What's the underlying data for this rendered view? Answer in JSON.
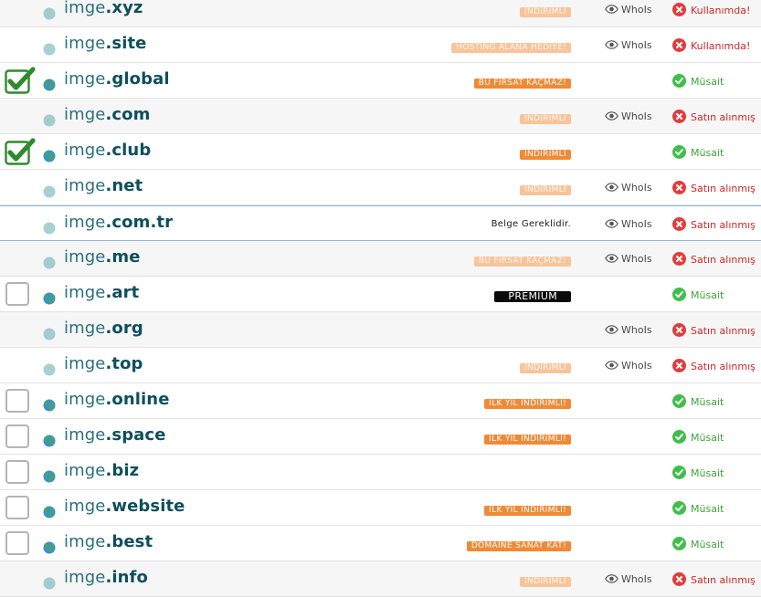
{
  "colors": {
    "accent": "#f08a35",
    "available": "#3fbf4a",
    "taken": "#e23c3c",
    "domain": "#1a5a66"
  },
  "rows": [
    {
      "name": "imge",
      "tld": ".xyz",
      "checkbox": "none",
      "globe_dim": true,
      "badge": "İNDİRİMLİ",
      "badge_style": "dim",
      "whois": "WhoIs",
      "status": "Kullanımda!",
      "status_type": "bad",
      "alt": true
    },
    {
      "name": "imge",
      "tld": ".site",
      "checkbox": "none",
      "globe_dim": true,
      "badge": "HOSTİNG ALANA HEDİYE!",
      "badge_style": "dim",
      "whois": "WhoIs",
      "status": "Kullanımda!",
      "status_type": "bad",
      "alt": false
    },
    {
      "name": "imge",
      "tld": ".global",
      "checkbox": "checked",
      "globe_dim": false,
      "badge": "BU FIRSAT KAÇMAZ!",
      "badge_style": "normal",
      "whois": "",
      "status": "Müsait",
      "status_type": "ok",
      "alt": false
    },
    {
      "name": "imge",
      "tld": ".com",
      "checkbox": "none",
      "globe_dim": true,
      "badge": "İNDİRİMLİ",
      "badge_style": "dim",
      "whois": "WhoIs",
      "status": "Satın alınmış",
      "status_type": "bad",
      "alt": true
    },
    {
      "name": "imge",
      "tld": ".club",
      "checkbox": "checked",
      "globe_dim": false,
      "badge": "İNDİRİMLİ",
      "badge_style": "normal",
      "whois": "",
      "status": "Müsait",
      "status_type": "ok",
      "alt": false
    },
    {
      "name": "imge",
      "tld": ".net",
      "checkbox": "none",
      "globe_dim": true,
      "badge": "İNDİRİMLİ",
      "badge_style": "dim",
      "whois": "WhoIs",
      "status": "Satın alınmış",
      "status_type": "bad",
      "alt": false
    },
    {
      "name": "imge",
      "tld": ".com.tr",
      "checkbox": "none",
      "globe_dim": true,
      "badge": "Belge Gereklidir.",
      "badge_style": "note",
      "whois": "WhoIs",
      "status": "Satın alınmış",
      "status_type": "bad",
      "alt": false,
      "selected": true
    },
    {
      "name": "imge",
      "tld": ".me",
      "checkbox": "none",
      "globe_dim": true,
      "badge": "BU FIRSAT KAÇMAZ!",
      "badge_style": "dim",
      "whois": "WhoIs",
      "status": "Satın alınmış",
      "status_type": "bad",
      "alt": true
    },
    {
      "name": "imge",
      "tld": ".art",
      "checkbox": "empty",
      "globe_dim": false,
      "badge": "PREMIUM",
      "badge_style": "premium",
      "whois": "",
      "status": "Müsait",
      "status_type": "ok",
      "alt": false
    },
    {
      "name": "imge",
      "tld": ".org",
      "checkbox": "none",
      "globe_dim": true,
      "badge": "",
      "badge_style": "",
      "whois": "WhoIs",
      "status": "Satın alınmış",
      "status_type": "bad",
      "alt": true
    },
    {
      "name": "imge",
      "tld": ".top",
      "checkbox": "none",
      "globe_dim": true,
      "badge": "İNDİRİMLİ",
      "badge_style": "dim",
      "whois": "WhoIs",
      "status": "Satın alınmış",
      "status_type": "bad",
      "alt": false
    },
    {
      "name": "imge",
      "tld": ".online",
      "checkbox": "empty",
      "globe_dim": false,
      "badge": "İLK YIL İNDİRİMLİ!",
      "badge_style": "normal",
      "whois": "",
      "status": "Müsait",
      "status_type": "ok",
      "alt": false
    },
    {
      "name": "imge",
      "tld": ".space",
      "checkbox": "empty",
      "globe_dim": false,
      "badge": "İLK YIL İNDİRİMLİ!",
      "badge_style": "normal",
      "whois": "",
      "status": "Müsait",
      "status_type": "ok",
      "alt": false
    },
    {
      "name": "imge",
      "tld": ".biz",
      "checkbox": "empty",
      "globe_dim": false,
      "badge": "",
      "badge_style": "",
      "whois": "",
      "status": "Müsait",
      "status_type": "ok",
      "alt": false
    },
    {
      "name": "imge",
      "tld": ".website",
      "checkbox": "empty",
      "globe_dim": false,
      "badge": "İLK YIL İNDİRİMLİ!",
      "badge_style": "normal",
      "whois": "",
      "status": "Müsait",
      "status_type": "ok",
      "alt": false
    },
    {
      "name": "imge",
      "tld": ".best",
      "checkbox": "empty",
      "globe_dim": false,
      "badge": "DOMAİNE SANAT KAT!",
      "badge_style": "normal",
      "whois": "",
      "status": "Müsait",
      "status_type": "ok",
      "alt": false
    },
    {
      "name": "imge",
      "tld": ".info",
      "checkbox": "none",
      "globe_dim": true,
      "badge": "İNDİRİMLİ",
      "badge_style": "dim",
      "whois": "WhoIs",
      "status": "Satın alınmış",
      "status_type": "bad",
      "alt": true
    }
  ]
}
